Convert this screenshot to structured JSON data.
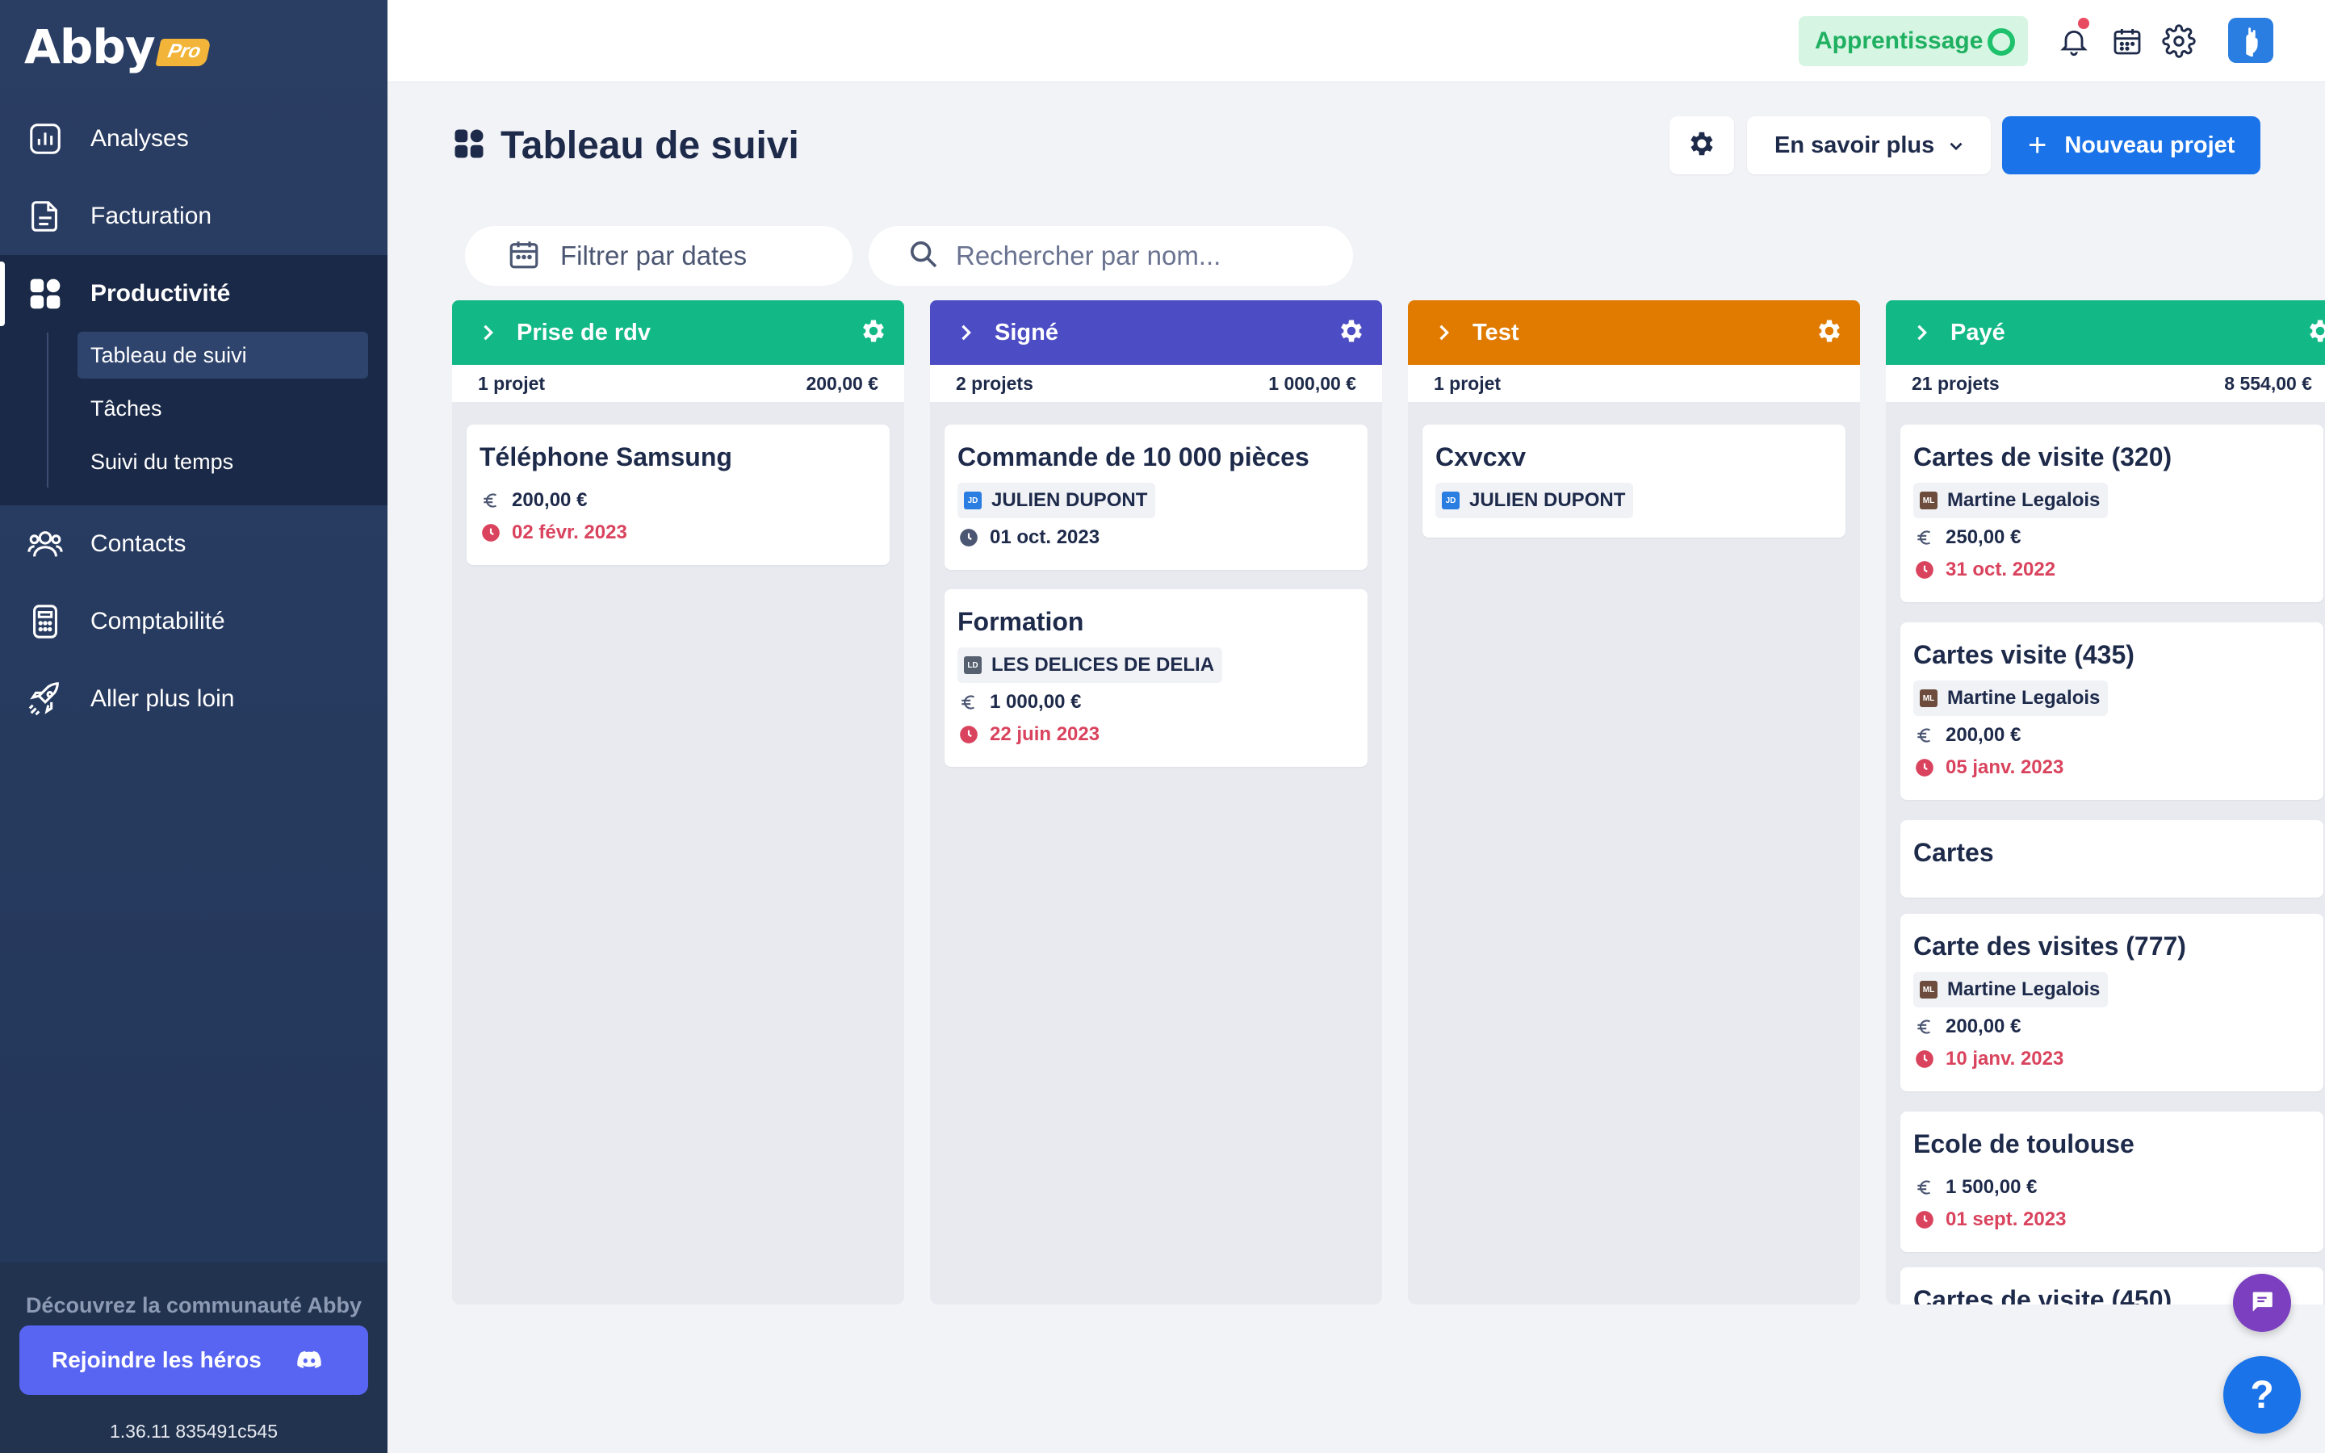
{
  "brand": {
    "name": "Abby",
    "badge": "Pro"
  },
  "sidebar": {
    "items": [
      {
        "label": "Analyses",
        "icon": "chart-icon"
      },
      {
        "label": "Facturation",
        "icon": "document-icon"
      },
      {
        "label": "Productivité",
        "icon": "grid-icon"
      },
      {
        "label": "Contacts",
        "icon": "users-icon"
      },
      {
        "label": "Comptabilité",
        "icon": "calculator-icon"
      },
      {
        "label": "Aller plus loin",
        "icon": "rocket-icon"
      }
    ],
    "subitems": [
      {
        "label": "Tableau de suivi",
        "active": true
      },
      {
        "label": "Tâches"
      },
      {
        "label": "Suivi du temps"
      }
    ],
    "community_text": "Découvrez la communauté Abby",
    "heroes_button": "Rejoindre les héros",
    "version": "1.36.11 835491c545"
  },
  "topbar": {
    "learning_label": "Apprentissage"
  },
  "header": {
    "title": "Tableau de suivi",
    "learn_more": "En savoir plus",
    "new_project": "Nouveau projet"
  },
  "filters": {
    "date_placeholder": "Filtrer par dates",
    "search_placeholder": "Rechercher par nom..."
  },
  "columns": [
    {
      "name": "Prise de rdv",
      "color": "#12b886",
      "count": "1 projet",
      "total": "200,00 €",
      "cards": [
        {
          "title": "Téléphone Samsung",
          "amount": "200,00 €",
          "date": "02 févr. 2023"
        }
      ]
    },
    {
      "name": "Signé",
      "color": "#4c4cc4",
      "count": "2 projets",
      "total": "1 000,00 €",
      "cards": [
        {
          "title": "Commande de 10 000 pièces",
          "contact": "JULIEN DUPONT",
          "date": "01 oct. 2023"
        },
        {
          "title": "Formation",
          "contact": "LES DELICES DE DELIA",
          "amount": "1 000,00 €",
          "date": "22 juin 2023"
        }
      ]
    },
    {
      "name": "Test",
      "color": "#e07b00",
      "count": "1 projet",
      "total": "",
      "cards": [
        {
          "title": "Cxvcxv",
          "contact": "JULIEN DUPONT"
        }
      ]
    },
    {
      "name": "Payé",
      "color": "#12b886",
      "count": "21 projets",
      "total": "8 554,00 €",
      "cards": [
        {
          "title": "Cartes de visite (320)",
          "contact": "Martine Legalois",
          "amount": "250,00 €",
          "date": "31 oct. 2022"
        },
        {
          "title": "Cartes visite (435)",
          "contact": "Martine Legalois",
          "amount": "200,00 €",
          "date": "05 janv. 2023"
        },
        {
          "title": "Cartes"
        },
        {
          "title": "Carte des visites (777)",
          "contact": "Martine Legalois",
          "amount": "200,00 €",
          "date": "10 janv. 2023"
        },
        {
          "title": "Ecole de toulouse",
          "amount": "1 500,00 €",
          "date": "01 sept. 2023"
        },
        {
          "title": "Cartes de visite (450)"
        }
      ]
    }
  ]
}
